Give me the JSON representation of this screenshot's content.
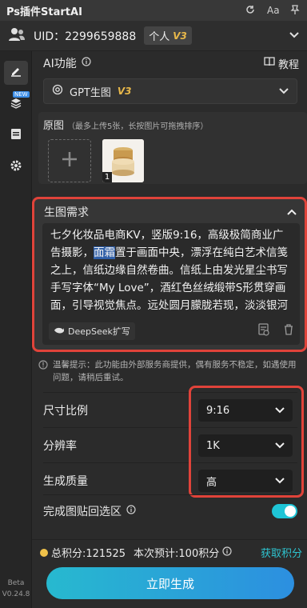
{
  "app": {
    "title": "Ps插件StartAI"
  },
  "titlebar": {
    "refresh_icon": "refresh-icon",
    "font_label": "Aa",
    "pin_icon": "pin-icon"
  },
  "user": {
    "uid": "UID：2299659888",
    "plan": "个人",
    "plan_tier": "V3"
  },
  "rail": {
    "new_tag": "NEW",
    "beta_label": "Beta",
    "version": "V0.24.8"
  },
  "ai_function": {
    "label": "AI功能",
    "tutorial": "教程"
  },
  "model": {
    "name": "GPT生图",
    "tier": "V3"
  },
  "source_image": {
    "label": "原图",
    "hint": "（最多上传5张，长按图片可拖拽排序）",
    "thumb_index": "1"
  },
  "prompt": {
    "label": "生图需求",
    "text_before": "七夕化妆品电商KV，竖版9:16，高级极简商业广告摄影，",
    "text_selected": "面霜",
    "text_after": "置于画面中央，漂浮在纯白艺术信笺之上，信纸边缘自然卷曲。信纸上由发光星尘书写手写字体“My Love”，酒红色丝绒缎带S形贯穿画面，引导视觉焦点。远处圆月朦胧若现，淡淡银河铺陈背景，散落珍珠、水晶露珠",
    "deepseek_label": "DeepSeek扩写"
  },
  "notice": {
    "text": "温馨提示：此功能由外部服务商提供，偶有服务不稳定，如遇使用问题，请稍后重试。"
  },
  "settings": {
    "aspect_label": "尺寸比例",
    "aspect_value": "9:16",
    "resolution_label": "分辨率",
    "resolution_value": "1K",
    "quality_label": "生成质量",
    "quality_value": "高",
    "paste_back_label": "完成图贴回选区",
    "paste_back_on": true
  },
  "footer": {
    "total_points": "总积分:121525",
    "estimate": "本次预计:100积分",
    "get_points": "获取积分",
    "generate": "立即生成"
  },
  "colors": {
    "accent": "#2ec4d0",
    "highlight_border": "#e0433a",
    "tier_gold": "#e8b84a"
  }
}
